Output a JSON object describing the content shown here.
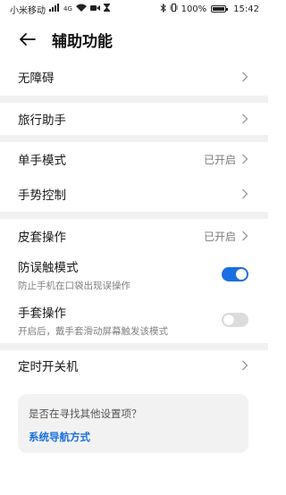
{
  "statusbar": {
    "carrier": "小米移动",
    "signal": "4G",
    "battery": "100%",
    "battery_level": 1.0,
    "time": "15:42"
  },
  "header": {
    "title": "辅助功能"
  },
  "rows": {
    "accessibility": {
      "label": "无障碍"
    },
    "travel": {
      "label": "旅行助手"
    },
    "onehand": {
      "label": "单手模式",
      "value": "已开启"
    },
    "gesture": {
      "label": "手势控制"
    },
    "cover": {
      "label": "皮套操作",
      "value": "已开启"
    },
    "pocket": {
      "label": "防误触模式",
      "sub": "防止手机在口袋出现误操作",
      "enabled": true
    },
    "glove": {
      "label": "手套操作",
      "sub": "开启后，戴手套滑动屏幕触发该模式",
      "enabled": false
    },
    "timer": {
      "label": "定时开关机"
    }
  },
  "card": {
    "question": "是否在寻找其他设置项？",
    "link": "系统导航方式"
  },
  "colors": {
    "accent": "#1a6fe0",
    "separator": "#f1f1f1"
  }
}
